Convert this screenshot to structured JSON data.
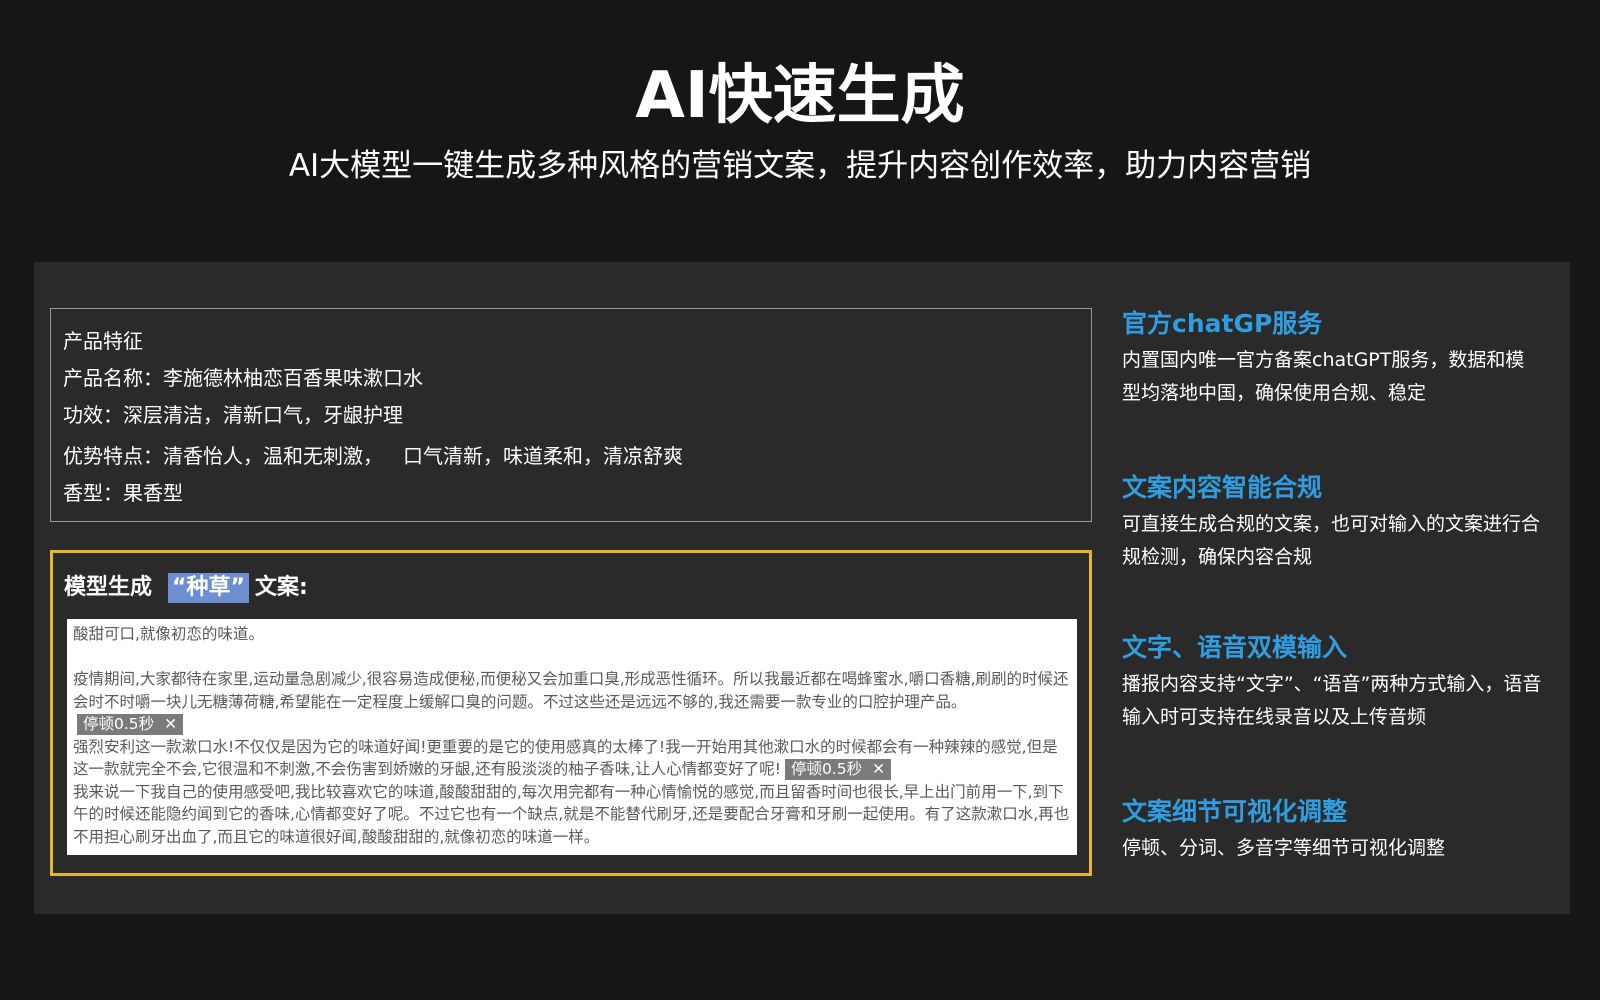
{
  "header": {
    "title": "AI快速生成",
    "subtitle": "AI大模型一键生成多种风格的营销文案，提升内容创作效率，助力内容营销"
  },
  "product": {
    "heading": "产品特征",
    "name": "产品名称：李施德林柚恋百香果味漱口水",
    "effect": "功效：深层清洁，清新口气，牙龈护理",
    "advantage_a": "优势特点：清香怡人，温和无刺激，",
    "advantage_b": "口气清新，味道柔和，清凉舒爽",
    "scent": "香型：果香型"
  },
  "generated": {
    "title_prefix": "模型生成",
    "style_tag": "“种草”",
    "title_suffix": "文案:",
    "line1": "酸甜可口,就像初恋的味道。",
    "para2": "疫情期间,大家都待在家里,运动量急剧减少,很容易造成便秘,而便秘又会加重口臭,形成恶性循环。所以我最近都在喝蜂蜜水,嚼口香糖,刷刷的时候还会时不时嚼一块儿无糖薄荷糖,希望能在一定程度上缓解口臭的问题。不过这些还是远远不够的,我还需要一款专业的口腔护理产品。",
    "para3": "强烈安利这一款漱口水!不仅仅是因为它的味道好闻!更重要的是它的使用感真的太棒了!我一开始用其他漱口水的时候都会有一种辣辣的感觉,但是这一款就完全不会,它很温和不刺激,不会伤害到娇嫩的牙龈,还有股淡淡的柚子香味,让人心情都变好了呢!",
    "para4": "我来说一下我自己的使用感受吧,我比较喜欢它的味道,酸酸甜甜的,每次用完都有一种心情愉悦的感觉,而且留香时间也很长,早上出门前用一下,到下午的时候还能隐约闻到它的香味,心情都变好了呢。不过它也有一个缺点,就是不能替代刷牙,还是要配合牙膏和牙刷一起使用。有了这款漱口水,再也不用担心刷牙出血了,而且它的味道很好闻,酸酸甜甜的,就像初恋的味道一样。",
    "pause_label": "停顿0.5秒",
    "close_glyph": "✕"
  },
  "features": [
    {
      "title": "官方chatGP服务",
      "desc": "内置国内唯一官方备案chatGPT服务，数据和模型均落地中国，确保使用合规、稳定"
    },
    {
      "title": "文案内容智能合规",
      "desc": "可直接生成合规的文案，也可对输入的文案进行合规检测，确保内容合规"
    },
    {
      "title": "文字、语音双模输入",
      "desc": "播报内容支持“文字”、“语音”两种方式输入，语音输入时可支持在线录音以及上传音频"
    },
    {
      "title": "文案细节可视化调整",
      "desc": "停顿、分词、多音字等细节可视化调整"
    }
  ],
  "colors": {
    "background": "#161619",
    "panel": "#2a2a2a",
    "accent_blue": "#2f9de0",
    "accent_yellow": "#e7b528",
    "tag_highlight": "#6d8fd2",
    "pause_tag": "#7b7b7b"
  }
}
